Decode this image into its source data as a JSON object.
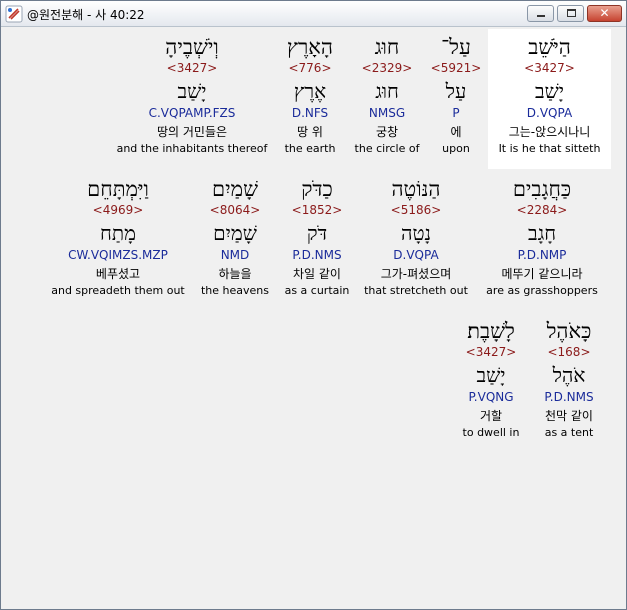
{
  "window": {
    "title": "@원전분해 - 사 40:22"
  },
  "rows": [
    {
      "words": [
        {
          "heb": "הַיֹּשֵׁב",
          "strong": "<3427>",
          "lemma": "יָשַׁב",
          "morph": "D.VQPA",
          "kor": "그는-앉으시나니",
          "eng": "It is he that sitteth",
          "highlight": true
        },
        {
          "heb": "עַל־",
          "strong": "<5921>",
          "lemma": "עַל",
          "morph": "P",
          "kor": "에",
          "eng": "upon",
          "highlight": false
        },
        {
          "heb": "חוּג",
          "strong": "<2329>",
          "lemma": "חוּג",
          "morph": "NMSG",
          "kor": "궁창",
          "eng": "the circle of",
          "highlight": false
        },
        {
          "heb": "הָאָרֶץ",
          "strong": "<776>",
          "lemma": "אֶרֶץ",
          "morph": "D.NFS",
          "kor": "땅 위",
          "eng": "the earth",
          "highlight": false
        },
        {
          "heb": "וְיֹשְׁבֶיהָ",
          "strong": "<3427>",
          "lemma": "יָשַׁב",
          "morph": "C.VQPAMP.FZS",
          "kor": "땅의 거민들은",
          "eng": "and the inhabitants thereof",
          "highlight": false
        }
      ]
    },
    {
      "words": [
        {
          "heb": "כַּחֲגָבִים",
          "strong": "<2284>",
          "lemma": "חָגָב",
          "morph": "P.D.NMP",
          "kor": "메뚜기 같으니라",
          "eng": "are as grasshoppers",
          "highlight": false
        },
        {
          "heb": "הַנּוֹטֶה",
          "strong": "<5186>",
          "lemma": "נָטָה",
          "morph": "D.VQPA",
          "kor": "그가-펴셨으며",
          "eng": "that stretcheth out",
          "highlight": false
        },
        {
          "heb": "כַדֹּק",
          "strong": "<1852>",
          "lemma": "דֹּק",
          "morph": "P.D.NMS",
          "kor": "차일 같이",
          "eng": "as a curtain",
          "highlight": false
        },
        {
          "heb": "שָׁמַיִם",
          "strong": "<8064>",
          "lemma": "שָׁמַיִם",
          "morph": "NMD",
          "kor": "하늘을",
          "eng": "the heavens",
          "highlight": false
        },
        {
          "heb": "וַיִּמְתָּחֵם",
          "strong": "<4969>",
          "lemma": "מָתַח",
          "morph": "CW.VQIMZS.MZP",
          "kor": "베푸셨고",
          "eng": "and spreadeth them out",
          "highlight": false
        }
      ]
    },
    {
      "words": [
        {
          "heb": "כָּאֹהֶל",
          "strong": "<168>",
          "lemma": "אֹהֶל",
          "morph": "P.D.NMS",
          "kor": "천막 같이",
          "eng": "as a tent",
          "highlight": false
        },
        {
          "heb": "לָשָׁבֶת׃",
          "strong": "<3427>",
          "lemma": "יָשַׁב",
          "morph": "P.VQNG",
          "kor": "거할",
          "eng": "to dwell in",
          "highlight": false
        }
      ]
    }
  ]
}
